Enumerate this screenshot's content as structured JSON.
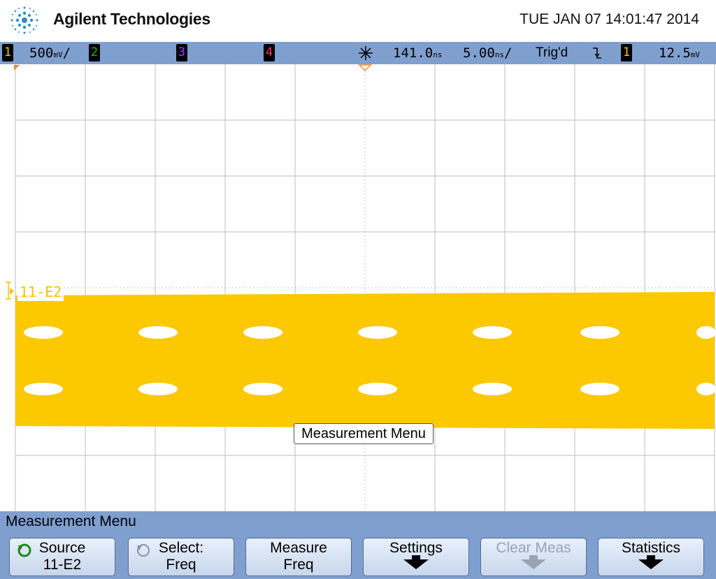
{
  "header": {
    "brand": "Agilent Technologies",
    "datetime": "TUE JAN 07 14:01:47 2014"
  },
  "status": {
    "ch1_number": "1",
    "ch1_scale": "500",
    "ch1_unit": "mV",
    "ch2_number": "2",
    "ch3_number": "3",
    "ch4_number": "4",
    "time_delay": "141.0",
    "time_delay_unit": "ns",
    "time_scale": "5.00",
    "time_scale_unit": "ns",
    "trigger_status": "Trig'd",
    "trigger_source": "1",
    "trigger_level": "12.5",
    "trigger_level_unit": "mV"
  },
  "channel": {
    "label": "11-E2",
    "marker": "1"
  },
  "overlay": {
    "menu_tag": "Measurement Menu"
  },
  "menu": {
    "title": "Measurement Menu",
    "softkeys": [
      {
        "line1": "Source",
        "line2": "11-E2"
      },
      {
        "line1": "Select:",
        "line2": "Freq"
      },
      {
        "line1": "Measure",
        "line2": "Freq"
      },
      {
        "line1": "Settings",
        "line2": ""
      },
      {
        "line1": "Clear Meas",
        "line2": ""
      },
      {
        "line1": "Statistics",
        "line2": ""
      }
    ]
  },
  "colors": {
    "ch1": "#f5c400",
    "ch2": "#00c000",
    "ch3": "#a040ff",
    "ch4": "#ff3070",
    "bar": "#7f9fcf"
  }
}
